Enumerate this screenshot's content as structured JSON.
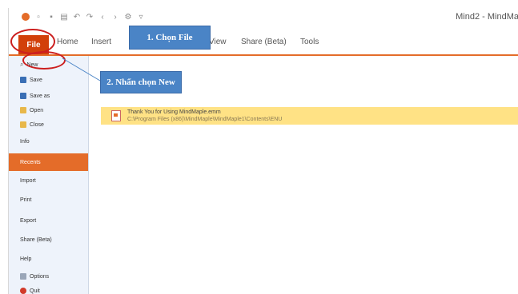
{
  "window": {
    "title": "Mind2 - MindMa",
    "quick_access": [
      "logo-icon",
      "new-icon",
      "save-icon",
      "print-icon",
      "undo-icon",
      "redo-icon",
      "back-icon",
      "forward-icon",
      "settings-icon",
      "dropdown-icon"
    ]
  },
  "ribbon": {
    "file_label": "File",
    "tabs": [
      "Home",
      "Insert",
      "View",
      "Share (Beta)",
      "Tools"
    ]
  },
  "callouts": {
    "step1": "1. Chọn File",
    "step2": "2. Nhấn chọn New"
  },
  "sidebar": {
    "items": [
      {
        "label": "New",
        "icon": "new-icon"
      },
      {
        "label": "Save",
        "icon": "save-icon"
      },
      {
        "label": "Save as",
        "icon": "save-as-icon"
      },
      {
        "label": "Open",
        "icon": "open-folder-icon"
      },
      {
        "label": "Close",
        "icon": "close-folder-icon"
      },
      {
        "label": "Info",
        "icon": ""
      },
      {
        "label": "Recents",
        "icon": ""
      },
      {
        "label": "Import",
        "icon": ""
      },
      {
        "label": "Print",
        "icon": ""
      },
      {
        "label": "Export",
        "icon": ""
      },
      {
        "label": "Share (Beta)",
        "icon": ""
      },
      {
        "label": "Help",
        "icon": ""
      },
      {
        "label": "Options",
        "icon": "options-icon"
      },
      {
        "label": "Quit",
        "icon": "quit-icon"
      }
    ],
    "active": "Recents"
  },
  "recent_files": [
    {
      "name": "Thank You for Using MindMaple.emm",
      "path": "C:\\Program Files (x86)\\MindMaple\\MindMaple1\\Contents\\ENU"
    }
  ],
  "colors": {
    "accent": "#e46c29",
    "file_tab": "#d2400a",
    "callout": "#4a84c6",
    "highlight_ring": "#cc1f1f",
    "recent_row": "#ffe285",
    "sidebar_bg": "#eef3fb"
  }
}
